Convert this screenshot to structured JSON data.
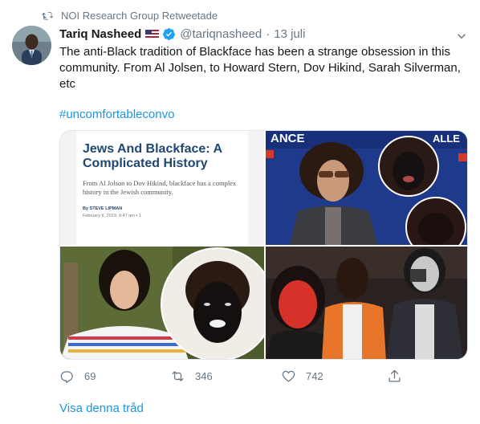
{
  "retweet_header": {
    "text": "NOI Research Group Retweetade"
  },
  "author": {
    "display_name": "Tariq Nasheed",
    "handle": "@tariqnasheed",
    "separator": "·",
    "timestamp": "13 juli"
  },
  "tweet": {
    "text": "The anti-Black tradition of Blackface has been a strange obsession in this community. From Al Jolsen, to Howard Stern, Dov Hikind, Sarah Silverman, etc",
    "hashtag": "#uncomfortableconvo"
  },
  "media": {
    "article": {
      "title": "Jews And Blackface: A Complicated History",
      "subtitle": "From Al Jolson to Dov Hikind, blackface has a complex history in the Jewish community.",
      "byline": "By STEVE LIPMAN",
      "date": "February 6, 2019, 9:47 am",
      "comments": "1"
    },
    "photo2": {
      "banner_left": "ANCE",
      "banner_right": "ALLE"
    }
  },
  "actions": {
    "replies": "69",
    "retweets": "346",
    "likes": "742"
  },
  "show_thread": "Visa denna tråd",
  "colors": {
    "link": "#1b95e0",
    "muted": "#657786",
    "verified": "#1da1f2",
    "article_title": "#1f4770"
  }
}
